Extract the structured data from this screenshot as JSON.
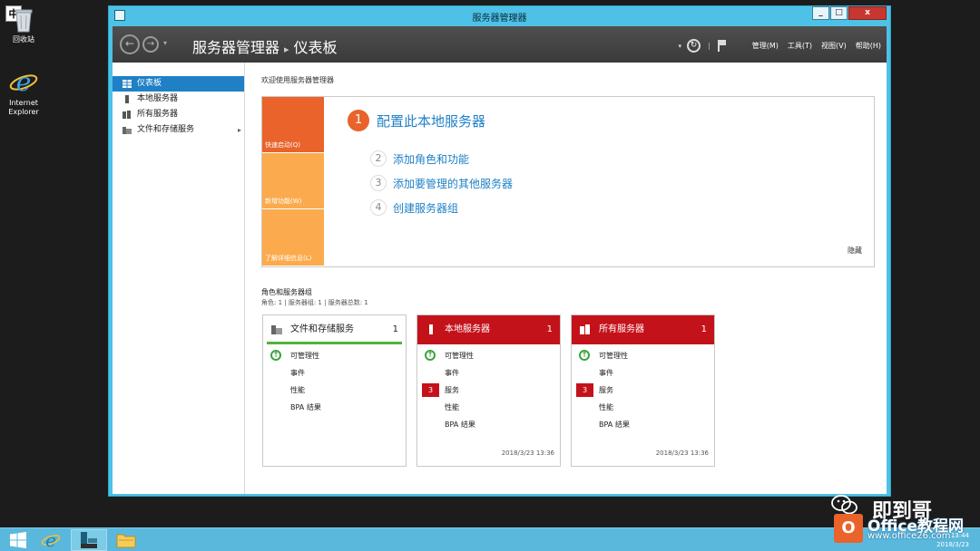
{
  "desktop": {
    "ime_label": "中",
    "icons": [
      {
        "label": "回收站"
      },
      {
        "label": "Internet Explorer"
      }
    ]
  },
  "window": {
    "title": "服务器管理器",
    "controls": {
      "minimize": "_",
      "maximize": "□",
      "close": "x"
    }
  },
  "toolbar": {
    "back": "←",
    "forward": "→",
    "dropdown": "▾",
    "breadcrumb_root": "服务器管理器",
    "breadcrumb_sep": "▸",
    "breadcrumb_current": "仪表板",
    "refresh": "↻",
    "menus": [
      "管理(M)",
      "工具(T)",
      "视图(V)",
      "帮助(H)"
    ]
  },
  "sidebar": {
    "items": [
      {
        "label": "仪表板",
        "active": true
      },
      {
        "label": "本地服务器"
      },
      {
        "label": "所有服务器"
      },
      {
        "label": "文件和存储服务",
        "chevron": "▸"
      }
    ]
  },
  "main": {
    "welcome": "欢迎使用服务器管理器",
    "quickstart": {
      "tabs": [
        "快速启动(Q)",
        "新增功能(W)",
        "了解详细信息(L)"
      ],
      "steps": [
        {
          "num": "1",
          "label": "配置此本地服务器"
        },
        {
          "num": "2",
          "label": "添加角色和功能"
        },
        {
          "num": "3",
          "label": "添加要管理的其他服务器"
        },
        {
          "num": "4",
          "label": "创建服务器组"
        }
      ],
      "hide": "隐藏"
    },
    "roles_heading": "角色和服务器组",
    "roles_sub": "角色: 1 | 服务器组: 1 | 服务器总数: 1",
    "tiles": [
      {
        "title": "文件和存储服务",
        "count": "1",
        "rows": [
          "可管理性",
          "事件",
          "性能",
          "BPA 结果"
        ]
      },
      {
        "title": "本地服务器",
        "count": "1",
        "rows": [
          "可管理性",
          "事件",
          "服务",
          "性能",
          "BPA 结果"
        ],
        "badge": "3",
        "timestamp": "2018/3/23 13:36"
      },
      {
        "title": "所有服务器",
        "count": "1",
        "rows": [
          "可管理性",
          "事件",
          "服务",
          "性能",
          "BPA 结果"
        ],
        "badge": "3",
        "timestamp": "2018/3/23 13:36"
      }
    ]
  },
  "taskbar": {
    "clock_time": "13:44",
    "clock_date": "2018/3/23"
  },
  "watermark": {
    "name": "即到哥",
    "brand": "Office教程网",
    "url": "www.office26.com",
    "logo_letter": "O"
  },
  "colors": {
    "accent_blue": "#1f80c6",
    "orange": "#e9632b",
    "light_orange": "#fbab4d",
    "alert_red": "#c4121b",
    "ok_green": "#52b33a",
    "window_frame": "#4ec1e6"
  }
}
